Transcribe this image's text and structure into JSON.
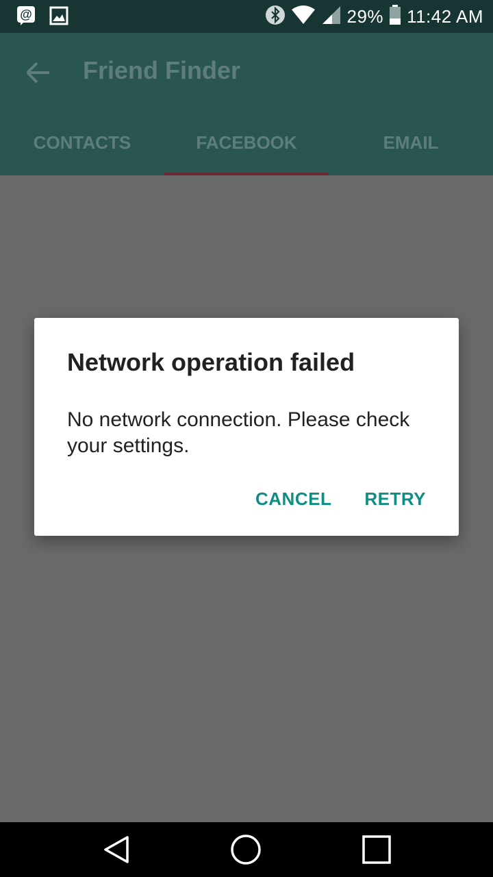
{
  "status_bar": {
    "battery_percent": "29%",
    "time": "11:42 AM",
    "icons": [
      "at-sign-icon",
      "image-icon",
      "bluetooth-icon",
      "wifi-icon",
      "signal-icon",
      "battery-icon"
    ]
  },
  "app_bar": {
    "title": "Friend Finder",
    "back_icon": "arrow-left-icon"
  },
  "tabs": [
    {
      "label": "CONTACTS",
      "active": false
    },
    {
      "label": "FACEBOOK",
      "active": true
    },
    {
      "label": "EMAIL",
      "active": false
    }
  ],
  "dialog": {
    "title": "Network operation failed",
    "message": "No network connection. Please check your settings.",
    "cancel_label": "CANCEL",
    "retry_label": "RETRY"
  },
  "colors": {
    "status_bar": "#173633",
    "app_bar": "#2a5652",
    "tab_indicator": "#6e2838",
    "dialog_button": "#0f8f83",
    "scrim": "#6a6a6a"
  },
  "nav_bar": {
    "icons": [
      "back-triangle-icon",
      "home-circle-icon",
      "recents-square-icon"
    ]
  }
}
